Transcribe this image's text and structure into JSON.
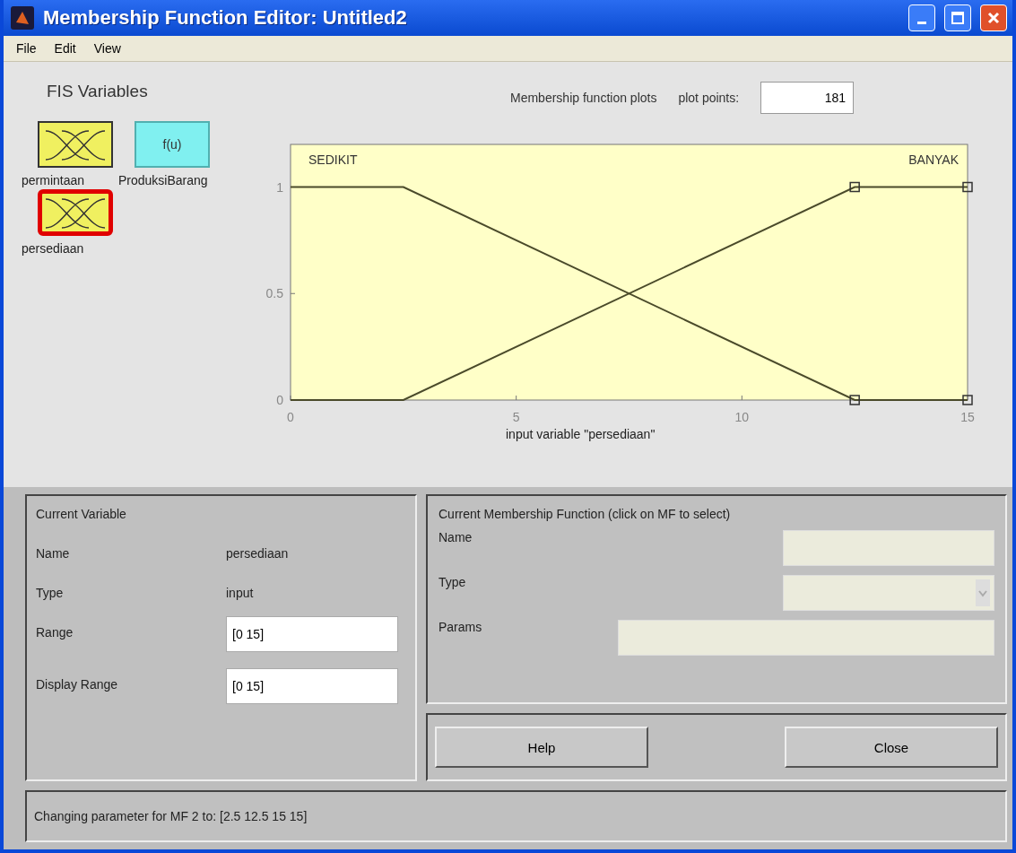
{
  "window": {
    "title": "Membership Function Editor: Untitled2"
  },
  "menu": [
    "File",
    "Edit",
    "View"
  ],
  "fis_variables": {
    "title": "FIS Variables",
    "items": [
      {
        "kind": "input",
        "label": "permintaan",
        "selected": false
      },
      {
        "kind": "output",
        "label": "ProduksiBarang",
        "glyph": "f(u)",
        "selected": false
      },
      {
        "kind": "input",
        "label": "persediaan",
        "selected": true
      }
    ]
  },
  "plot": {
    "title": "Membership function plots",
    "plot_points_label": "plot points:",
    "plot_points": "181",
    "chart_data": {
      "type": "line",
      "xlabel": "input variable \"persediaan\"",
      "x": [
        0,
        2.5,
        12.5,
        15
      ],
      "series": [
        {
          "name": "SEDIKIT",
          "color": "#4a4a2a",
          "values": [
            1,
            1,
            0,
            0
          ]
        },
        {
          "name": "BANYAK",
          "color": "#4a4a2a",
          "values": [
            0,
            0,
            1,
            1
          ]
        }
      ],
      "xlim": [
        0,
        15
      ],
      "ylim": [
        0,
        1.2
      ],
      "xticks": [
        0,
        5,
        10,
        15
      ],
      "yticks": [
        0,
        0.5,
        1
      ]
    }
  },
  "current_variable": {
    "title": "Current Variable",
    "name_label": "Name",
    "name": "persediaan",
    "type_label": "Type",
    "type": "input",
    "range_label": "Range",
    "range": "[0 15]",
    "display_range_label": "Display Range",
    "display_range": "[0 15]"
  },
  "current_mf": {
    "title": "Current Membership Function (click on MF to select)",
    "name_label": "Name",
    "type_label": "Type",
    "params_label": "Params",
    "disabled": true
  },
  "buttons": [
    "Help",
    "Close"
  ],
  "status": "Changing parameter for MF 2 to: [2.5 12.5 15 15]"
}
